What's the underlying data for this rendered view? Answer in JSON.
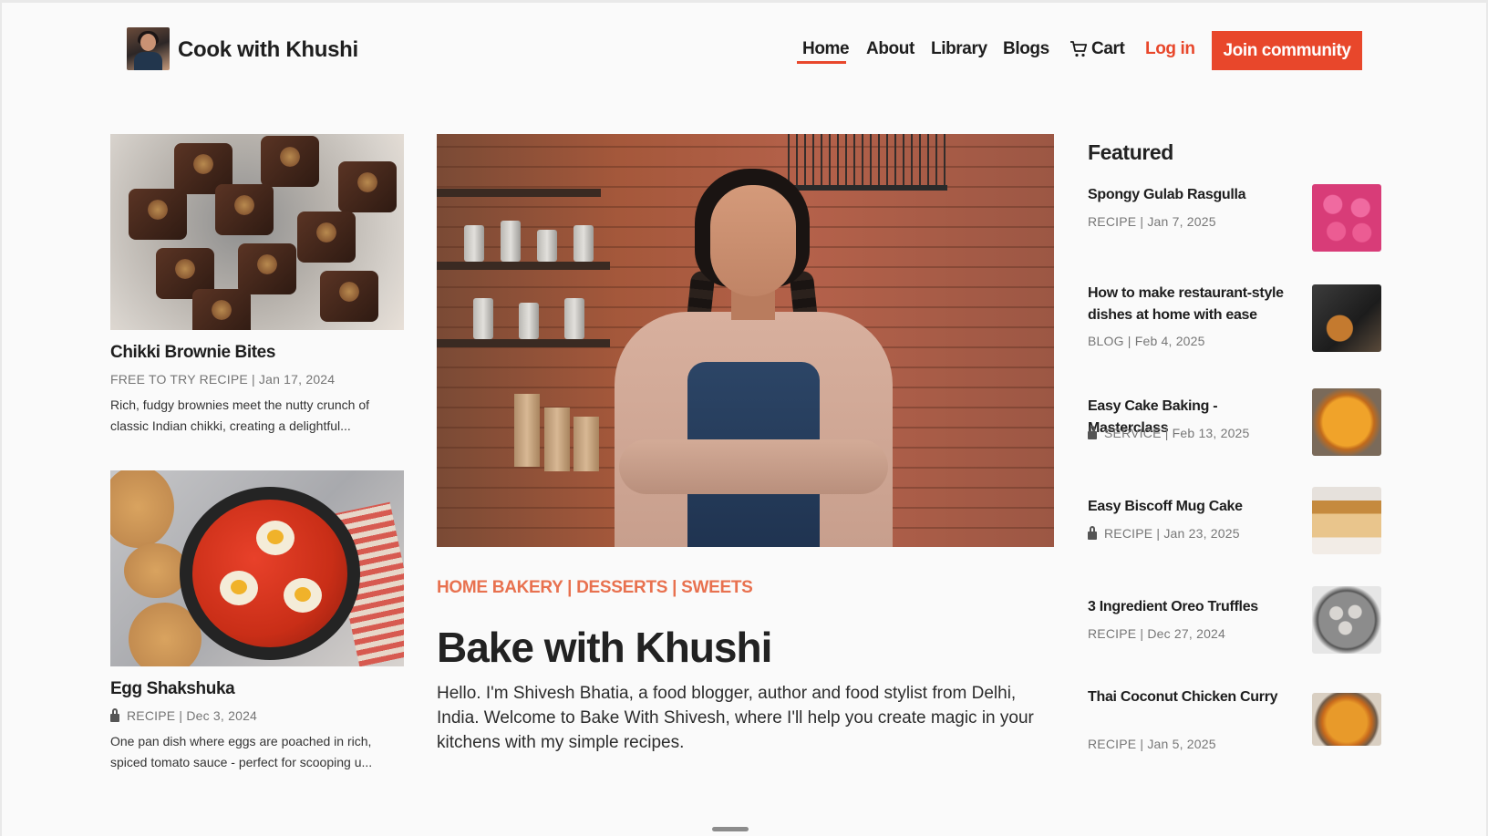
{
  "brand": {
    "name": "Cook with Khushi",
    "logo_icon": "chef-avatar"
  },
  "nav": {
    "home": "Home",
    "about": "About",
    "library": "Library",
    "blogs": "Blogs",
    "cart": "Cart",
    "cart_icon": "cart-icon",
    "login": "Log in",
    "join": "Join community"
  },
  "colors": {
    "accent": "#e8472b",
    "tag": "#e8714f"
  },
  "left_cards": [
    {
      "title": "Chikki Brownie Bites",
      "meta": "FREE TO TRY RECIPE | Jan 17, 2024",
      "desc": "Rich, fudgy brownies meet the nutty crunch of classic Indian chikki, creating a delightful..."
    },
    {
      "title": "Egg Shakshuka",
      "meta": "RECIPE | Dec 3, 2024",
      "locked": true,
      "desc": "One pan dish where eggs are poached in rich, spiced tomato sauce - perfect for scooping u..."
    }
  ],
  "hero": {
    "tags": "HOME BAKERY | DESSERTS | SWEETS",
    "title": "Bake with Khushi",
    "text": "Hello. I'm Shivesh Bhatia, a food blogger, author and food stylist from Delhi, India. Welcome to Bake With Shivesh, where I'll help you create magic in your kitchens with my simple recipes."
  },
  "featured": {
    "heading": "Featured",
    "items": [
      {
        "title": "Spongy Gulab Rasgulla",
        "meta": "RECIPE | Jan 7, 2025",
        "locked": false
      },
      {
        "title": "How to make restaurant-style dishes at home with ease",
        "meta": "BLOG | Feb 4, 2025",
        "locked": false
      },
      {
        "title": "Easy Cake Baking - Masterclass",
        "meta": "SERVICE | Feb 13, 2025",
        "locked": true
      },
      {
        "title": "Easy Biscoff Mug Cake",
        "meta": "RECIPE | Jan 23, 2025",
        "locked": true
      },
      {
        "title": "3 Ingredient Oreo Truffles",
        "meta": "RECIPE | Dec 27, 2024",
        "locked": false
      },
      {
        "title": "Thai Coconut Chicken Curry",
        "meta": "RECIPE | Jan 5, 2025",
        "locked": false
      }
    ]
  }
}
